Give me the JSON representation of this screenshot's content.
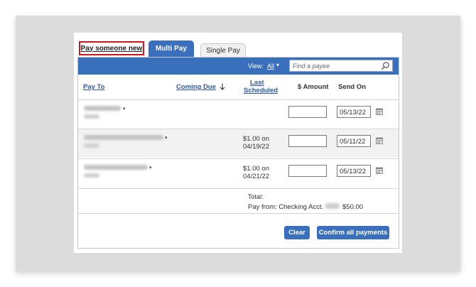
{
  "tabs": {
    "pay_someone_new": "Pay someone new",
    "multi_pay": "Multi Pay",
    "single_pay": "Single Pay"
  },
  "filter": {
    "view_label": "View:",
    "view_value": "All",
    "search_placeholder": "Find a payee"
  },
  "columns": {
    "pay_to": "Pay To",
    "coming_due": "Coming Due",
    "last_line1": "Last",
    "last_line2": "Scheduled",
    "amount": "$ Amount",
    "send_on": "Send On"
  },
  "rows": [
    {
      "last_line1": "",
      "last_line2": "",
      "amount": "",
      "send_on": "05/13/22"
    },
    {
      "last_line1": "$1.00 on",
      "last_line2": "04/19/22",
      "amount": "",
      "send_on": "05/11/22"
    },
    {
      "last_line1": "$1.00 on",
      "last_line2": "04/21/22",
      "amount": "",
      "send_on": "05/13/22"
    }
  ],
  "totals": {
    "total_label": "Total:",
    "pay_from": "Pay from: Checking Acct.",
    "amount": "$50.00"
  },
  "buttons": {
    "clear": "Clear",
    "confirm": "Confirm all payments"
  },
  "colors": {
    "accent": "#3a6fbd",
    "highlight_border": "#d0141c"
  },
  "icons": {
    "search": "search-icon",
    "calendar": "calendar-icon",
    "sort": "arrow-down-icon"
  }
}
